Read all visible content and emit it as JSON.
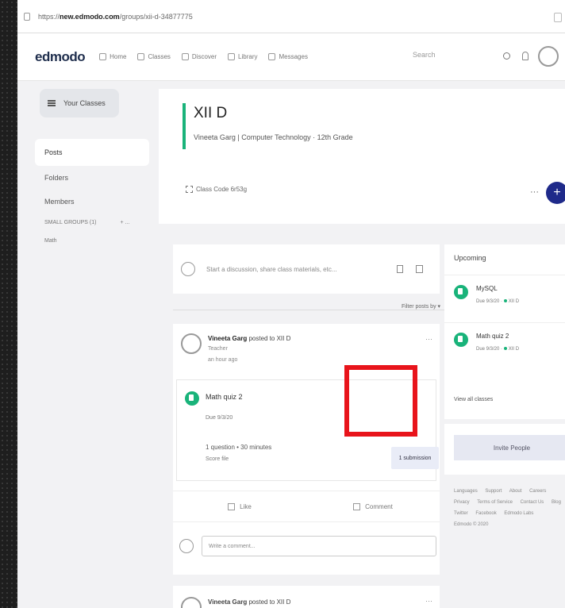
{
  "browser": {
    "url_prefix": "https://",
    "url_domain": "new.edmodo.com",
    "url_path": "/groups/xii-d-34877775"
  },
  "header": {
    "logo": "edmodo",
    "nav": [
      "Home",
      "Classes",
      "Discover",
      "Library",
      "Messages"
    ],
    "search_placeholder": "Search"
  },
  "sidebar": {
    "your_classes": "Your Classes",
    "items": [
      "Posts",
      "Folders",
      "Members"
    ],
    "small_groups": "SMALL GROUPS (1)",
    "small_groups_add": "+ ...",
    "group": "Math"
  },
  "class": {
    "title": "XII D",
    "subtitle": "Vineeta Garg | Computer Technology · 12th Grade",
    "code": "Class Code 6r53g",
    "more": "···",
    "add": "+"
  },
  "composer": {
    "placeholder": "Start a discussion, share class materials, etc..."
  },
  "filter": "Filter posts by ▾",
  "post": {
    "author": "Vineeta Garg",
    "posted_to": "posted to XII D",
    "role": "Teacher",
    "time": "an hour ago",
    "more": "···",
    "quiz": {
      "title": "Math quiz 2",
      "due": "Due 9/3/20",
      "meta": "1 question • 30 minutes",
      "show": "Score file",
      "submission": "1 submission"
    },
    "like": "Like",
    "comment": "Comment",
    "comment_placeholder": "Write a comment..."
  },
  "post2": {
    "author": "Vineeta Garg",
    "posted_to": "posted to XII D",
    "more": "···"
  },
  "upcoming": {
    "title": "Upcoming",
    "items": [
      {
        "name": "MySQL",
        "due": "Due 9/3/20",
        "class": "XII D"
      },
      {
        "name": "Math quiz 2",
        "due": "Due 9/3/20",
        "class": "XII D"
      }
    ],
    "view_all": "View all classes"
  },
  "invite": "Invite People",
  "footer": [
    "Languages",
    "Support",
    "About",
    "Careers",
    "Privacy",
    "Terms of Service",
    "Contact Us",
    "Blog",
    "Twitter",
    "Facebook",
    "Edmodo Labs",
    "Edmodo © 2020"
  ],
  "colors": {
    "accent_green": "#19b37a",
    "primary_navy": "#1f2a8a",
    "highlight_red": "#e8141b"
  }
}
